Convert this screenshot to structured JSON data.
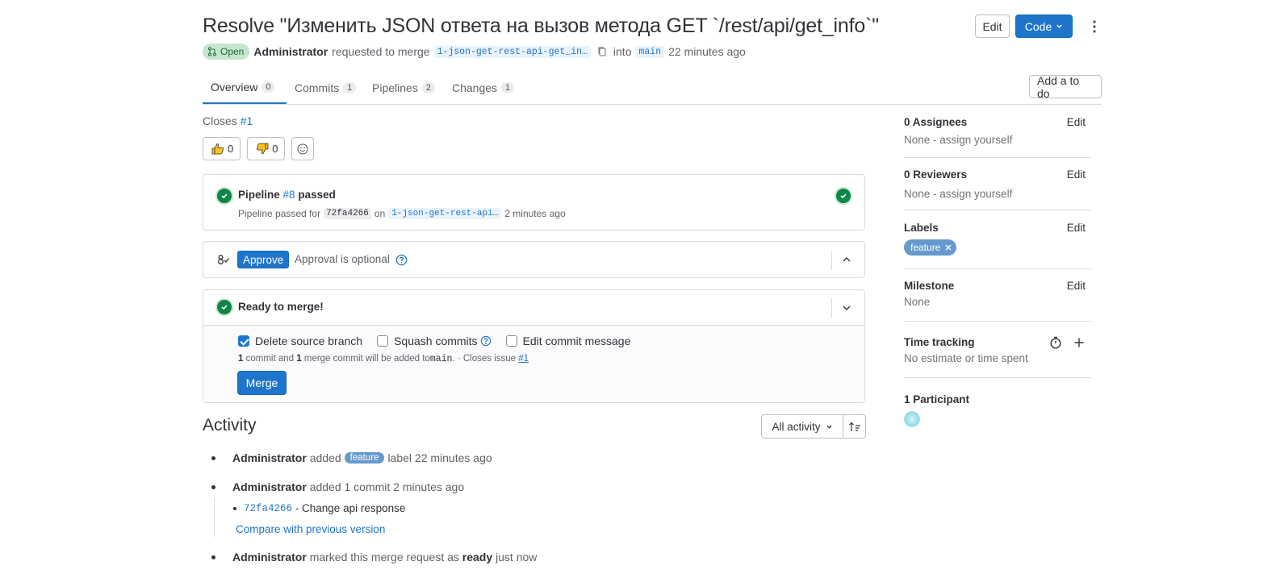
{
  "header": {
    "title": "Resolve \"Изменить JSON ответа на вызов метода GET `/rest/api/get_info`\"",
    "edit_label": "Edit",
    "code_label": "Code"
  },
  "meta": {
    "status": "Open",
    "author": "Administrator",
    "requested_text": "requested to merge",
    "source_branch": "1-json-get-rest-api-get_in…",
    "into_text": "into",
    "target_branch": "main",
    "time": "22 minutes ago"
  },
  "tabs": [
    {
      "label": "Overview",
      "count": "0"
    },
    {
      "label": "Commits",
      "count": "1"
    },
    {
      "label": "Pipelines",
      "count": "2"
    },
    {
      "label": "Changes",
      "count": "1"
    }
  ],
  "todo_label": "Add a to do",
  "closes": {
    "text": "Closes",
    "issue": "#1"
  },
  "reactions": {
    "thumbs_up": "0",
    "thumbs_down": "0"
  },
  "pipeline": {
    "prefix": "Pipeline",
    "id": "#8",
    "status": "passed",
    "detail_prefix": "Pipeline passed for",
    "commit": "72fa4266",
    "on_text": "on",
    "branch": "1-json-get-rest-api…",
    "time": "2 minutes ago"
  },
  "approval": {
    "button": "Approve",
    "text": "Approval is optional"
  },
  "merge": {
    "title": "Ready to merge!",
    "delete_source": "Delete source branch",
    "squash": "Squash commits",
    "edit_message": "Edit commit message",
    "summary_commit_count": "1",
    "summary_commit_word": "commit and",
    "summary_merge_count": "1",
    "summary_merge_word": "merge commit will be added to",
    "summary_branch": "main",
    "summary_tail": ". · Closes issue",
    "summary_issue": "#1",
    "button": "Merge"
  },
  "activity": {
    "title": "Activity",
    "filter": "All activity",
    "items": [
      {
        "author": "Administrator",
        "pre": "added",
        "label": "feature",
        "post": "label 22 minutes ago"
      },
      {
        "author": "Administrator",
        "text": "added 1 commit 2 minutes ago"
      },
      {
        "author": "Administrator",
        "pre": "marked this merge request as",
        "bold": "ready",
        "post": "just now"
      }
    ],
    "commit_sha": "72fa4266",
    "commit_msg": "- Change api response",
    "compare_link": "Compare with previous version"
  },
  "sidebar": {
    "assignees": {
      "title": "0 Assignees",
      "edit": "Edit",
      "value": "None - assign yourself"
    },
    "reviewers": {
      "title": "0 Reviewers",
      "edit": "Edit",
      "value": "None - assign yourself"
    },
    "labels": {
      "title": "Labels",
      "edit": "Edit",
      "label": "feature"
    },
    "milestone": {
      "title": "Milestone",
      "edit": "Edit",
      "value": "None"
    },
    "time_tracking": {
      "title": "Time tracking",
      "value": "No estimate or time spent"
    },
    "participants": {
      "title": "1 Participant"
    }
  },
  "colors": {
    "primary": "#1f75cb",
    "success": "#108548",
    "label": "#6699cc"
  }
}
